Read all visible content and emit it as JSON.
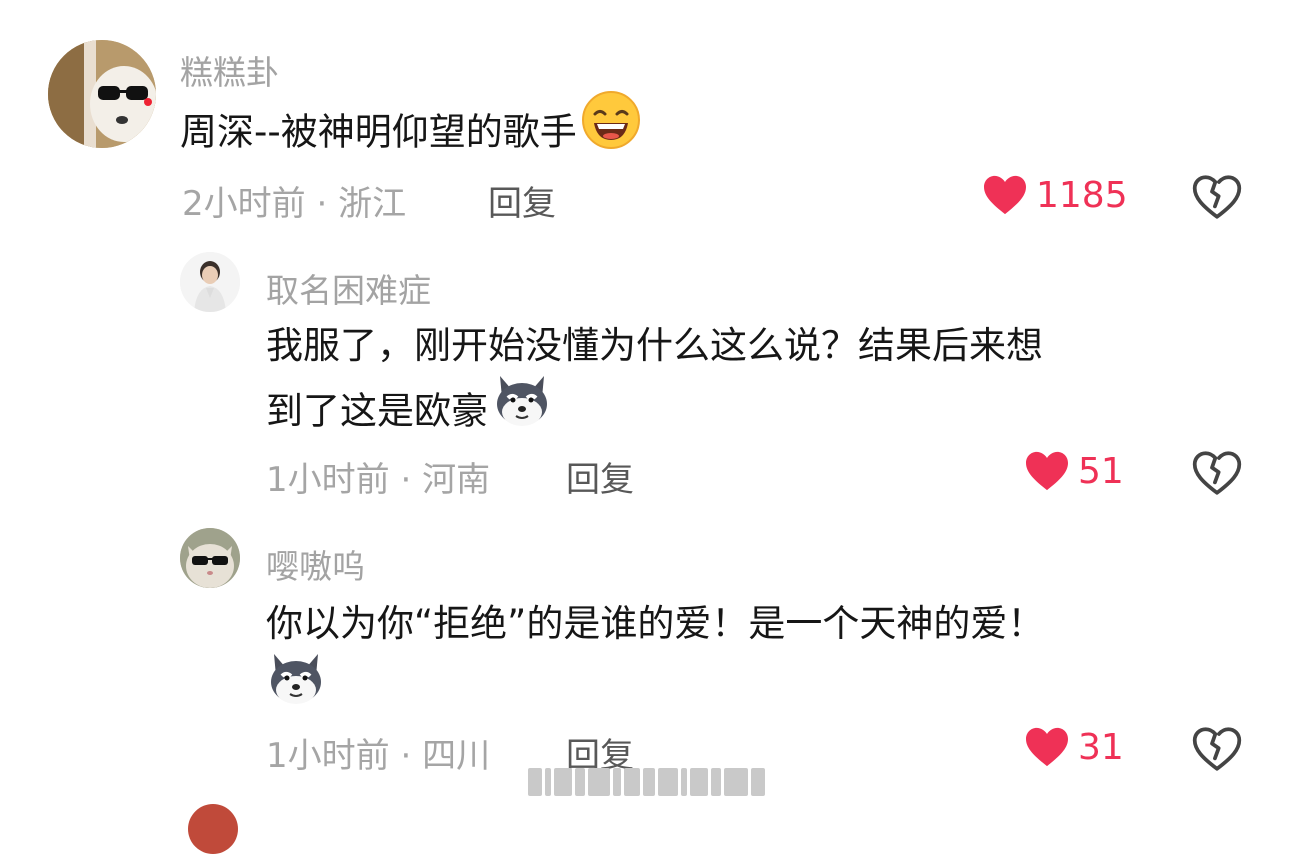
{
  "comments": [
    {
      "username": "糕糕卦",
      "text": "周深--被神明仰望的歌手",
      "emoji": "grinning-face-emoji",
      "time": "2小时前",
      "location": "浙江",
      "reply_label": "回复",
      "likes": "1185"
    },
    {
      "username": "取名困难症",
      "text_line1": "我服了，刚开始没懂为什么这么说？结果后来想",
      "text_line2": "到了这是欧豪",
      "emoji": "husky-dog-emoji",
      "time": "1小时前",
      "location": "河南",
      "reply_label": "回复",
      "likes": "51"
    },
    {
      "username": "嘤嗷呜",
      "text": "你以为你“拒绝”的是谁的爱！是一个天神的爱！",
      "emoji": "husky-dog-emoji",
      "time": "1小时前",
      "location": "四川",
      "reply_label": "回复",
      "likes": "31"
    }
  ],
  "meta_separator": " · ",
  "colors": {
    "like_red": "#ef3156",
    "username_gray": "#a3a3a3",
    "meta_gray": "#a5a5a5",
    "text": "#161616"
  }
}
